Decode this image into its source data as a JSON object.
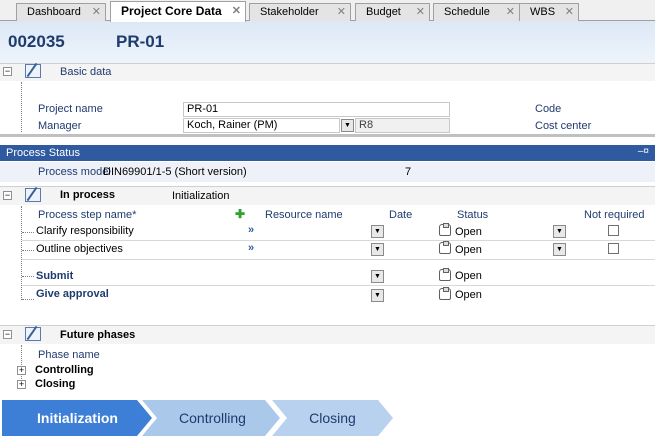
{
  "tabs": [
    {
      "label": "Dashboard"
    },
    {
      "label": "Project Core Data"
    },
    {
      "label": "Stakeholder"
    },
    {
      "label": "Budget"
    },
    {
      "label": "Schedule"
    },
    {
      "label": "WBS"
    }
  ],
  "header": {
    "project_id": "002035",
    "project_name": "PR-01"
  },
  "basic": {
    "title": "Basic data",
    "project_name_label": "Project name",
    "project_name_value": "PR-01",
    "manager_label": "Manager",
    "manager_value": "Koch, Rainer (PM)",
    "manager_extra": "R8",
    "code_label": "Code",
    "cost_center_label": "Cost center"
  },
  "process_status": {
    "title": "Process Status",
    "pin": "–¤",
    "model_label": "Process model",
    "model_value": "DIN69901/1-5 (Short version)",
    "model_number": "7"
  },
  "in_process": {
    "title": "In process",
    "phase": "Initialization",
    "columns": {
      "step": "Process step name*",
      "resource": "Resource name",
      "date": "Date",
      "status": "Status",
      "not_required": "Not required"
    },
    "steps": [
      {
        "name": "Clarify responsibility",
        "status": "Open"
      },
      {
        "name": "Outline objectives",
        "status": "Open"
      },
      {
        "name": "Submit",
        "status": "Open"
      },
      {
        "name": "Give approval",
        "status": "Open"
      }
    ]
  },
  "future": {
    "title": "Future phases",
    "phase_name_label": "Phase name",
    "phases": [
      {
        "name": "Controlling"
      },
      {
        "name": "Closing"
      }
    ]
  },
  "flow": {
    "steps": [
      "Initialization",
      "Controlling",
      "Closing"
    ]
  },
  "colors": {
    "accent": "#1f3b6e",
    "process_bar": "#2f5aa0",
    "chevron_active": "#3d7fd6",
    "chevron_inactive": "#9ec0e6"
  }
}
